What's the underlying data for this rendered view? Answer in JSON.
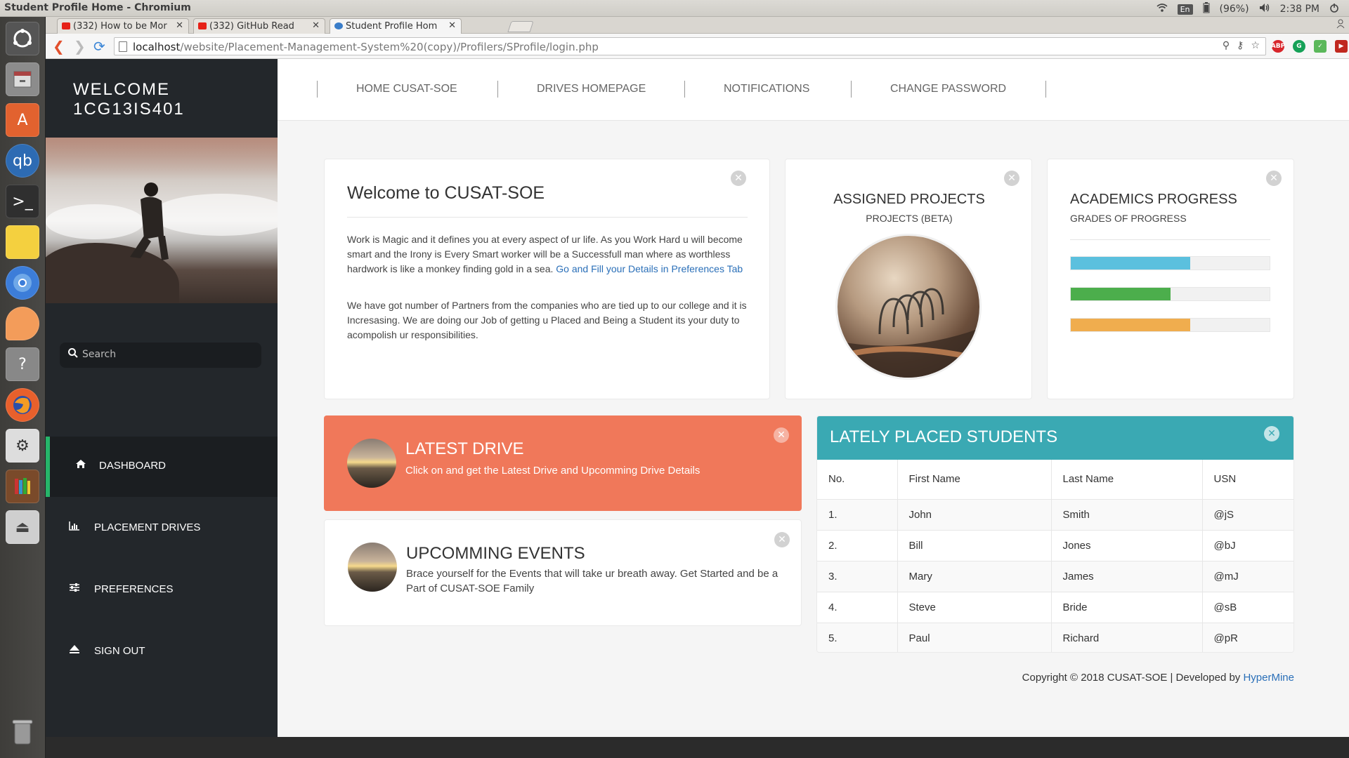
{
  "window": {
    "title": "Student Profile Home - Chromium"
  },
  "system": {
    "lang": "En",
    "battery": "(96%)",
    "time": "2:38 PM"
  },
  "tabs": [
    {
      "label": "(332) How to be Mor"
    },
    {
      "label": "(332) GitHub Read"
    },
    {
      "label": "Student Profile Hom"
    }
  ],
  "address": {
    "host": "localhost",
    "path": "/website/Placement-Management-System%20(copy)/Profilers/SProfile/login.php"
  },
  "extensions": [
    "ABP",
    "G",
    "✓",
    "▶",
    "✓",
    "◆"
  ],
  "sidebar": {
    "welcome_line1": "WELCOME",
    "welcome_line2": "1CG13IS401",
    "search_placeholder": "Search",
    "items": [
      {
        "label": "DASHBOARD",
        "icon": "home-icon"
      },
      {
        "label": "PLACEMENT DRIVES",
        "icon": "bar-chart-icon"
      },
      {
        "label": "PREFERENCES",
        "icon": "sliders-icon"
      },
      {
        "label": "SIGN OUT",
        "icon": "eject-icon"
      }
    ]
  },
  "topnav": [
    "HOME CUSAT-SOE",
    "DRIVES HOMEPAGE",
    "NOTIFICATIONS",
    "CHANGE PASSWORD"
  ],
  "welcome_card": {
    "title": "Welcome to CUSAT-SOE",
    "p1": "Work is Magic and it defines you at every aspect of ur life. As you Work Hard u will become smart and the Irony is Every Smart worker will be a Successfull man where as worthless hardwork is like a monkey finding gold in a sea. ",
    "p1_link": "Go and Fill your Details in Preferences Tab",
    "p2": "We have got number of Partners from the companies who are tied up to our college and it is Incresasing. We are doing our Job of getting u Placed and Being a Student its your duty to acompolish ur responsibilities."
  },
  "projects_card": {
    "title": "ASSIGNED PROJECTS",
    "subtitle": "PROJECTS (BETA)"
  },
  "academics_card": {
    "title": "ACADEMICS PROGRESS",
    "subtitle": "GRADES OF PROGRESS",
    "bars": [
      {
        "value": 0.6,
        "color": "#5bc0de"
      },
      {
        "value": 0.5,
        "color": "#4cae4c"
      },
      {
        "value": 0.6,
        "color": "#f0ad4e"
      }
    ]
  },
  "latest_drive": {
    "title": "LATEST DRIVE",
    "text": "Click on and get the Latest Drive and Upcomming Drive Details",
    "color": "#f0785a"
  },
  "events": {
    "title": "UPCOMMING EVENTS",
    "text": "Brace yourself for the Events that will take ur breath away. Get Started and be a Part of CUSAT-SOE Family"
  },
  "placed": {
    "title": "LATELY PLACED STUDENTS",
    "color": "#3aa9b3",
    "headers": [
      "No.",
      "First Name",
      "Last Name",
      "USN"
    ],
    "rows": [
      [
        "1.",
        "John",
        "Smith",
        "@jS"
      ],
      [
        "2.",
        "Bill",
        "Jones",
        "@bJ"
      ],
      [
        "3.",
        "Mary",
        "James",
        "@mJ"
      ],
      [
        "4.",
        "Steve",
        "Bride",
        "@sB"
      ],
      [
        "5.",
        "Paul",
        "Richard",
        "@pR"
      ]
    ]
  },
  "footer": {
    "text": "Copyright © 2018 CUSAT-SOE | Developed by ",
    "link": "HyperMine"
  }
}
